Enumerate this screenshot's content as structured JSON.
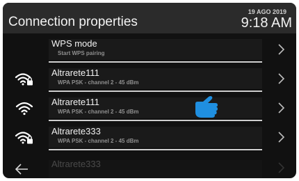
{
  "header": {
    "title": "Connection properties",
    "date": "19 AGO 2019",
    "time": "9:18 AM"
  },
  "rows": [
    {
      "name": "WPS mode",
      "sub": "Start WPS pairing",
      "icon": "none"
    },
    {
      "name": "Altrarete111",
      "sub": "WPA PSK - channel 2 - 45 dBm",
      "icon": "wifi-lock-icon"
    },
    {
      "name": "Altrarete111",
      "sub": "WPA PSK - channel 2 - 45 dBm",
      "icon": "wifi-icon"
    },
    {
      "name": "Altrarete333",
      "sub": "WPA PSK - channel 2 - 45 dBm",
      "icon": "wifi-lock-icon"
    },
    {
      "name": "Altrarete333",
      "sub": "",
      "icon": "none"
    }
  ],
  "colors": {
    "background": "#111111",
    "header": "#2b2b2b",
    "pointer": "#1f8fe0"
  }
}
